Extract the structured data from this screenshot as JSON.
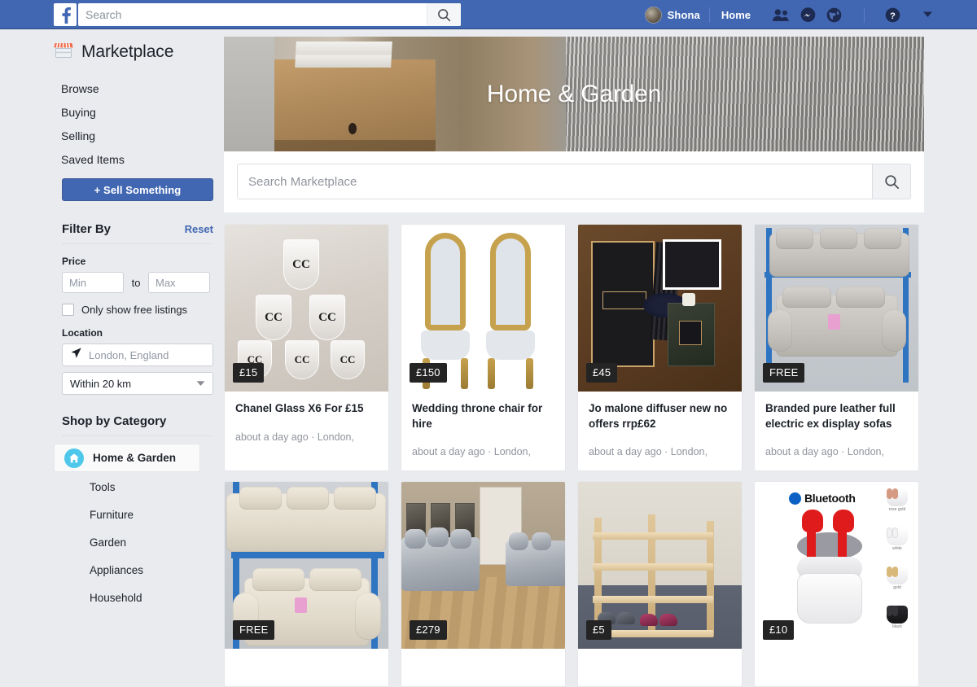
{
  "topbar": {
    "logo_icon": "facebook-f-icon",
    "search_placeholder": "Search",
    "search_value": "",
    "search_icon": "search-icon",
    "user_name": "Shona",
    "home_label": "Home",
    "icons": [
      "friend-requests-icon",
      "messenger-icon",
      "notifications-globe-icon",
      "help-question-icon",
      "account-caret-down-icon"
    ]
  },
  "sidebar": {
    "marketplace_icon": "storefront-icon",
    "marketplace_title": "Marketplace",
    "nav": [
      {
        "label": "Browse"
      },
      {
        "label": "Buying"
      },
      {
        "label": "Selling"
      },
      {
        "label": "Saved Items"
      }
    ],
    "sell_button": "+  Sell Something",
    "filter": {
      "title": "Filter By",
      "reset": "Reset",
      "price_label": "Price",
      "price_min_placeholder": "Min",
      "price_min_value": "",
      "price_max_placeholder": "Max",
      "price_max_value": "",
      "price_to": "to",
      "free_checkbox_label": "Only show free listings",
      "free_checked": false,
      "location_label": "Location",
      "location_icon": "navigation-arrow-icon",
      "location_placeholder": "London, England",
      "location_value": "",
      "distance_value": "Within 20 km",
      "distance_caret": "chevron-down-icon"
    },
    "category": {
      "heading": "Shop by Category",
      "active": {
        "label": "Home & Garden",
        "icon": "home-icon",
        "icon_color": "#4ec7ea"
      },
      "subcategories": [
        {
          "label": "Tools"
        },
        {
          "label": "Furniture"
        },
        {
          "label": "Garden"
        },
        {
          "label": "Appliances"
        },
        {
          "label": "Household"
        }
      ]
    }
  },
  "main": {
    "hero_title": "Home & Garden",
    "search_placeholder": "Search Marketplace",
    "search_value": "",
    "search_icon": "search-icon",
    "listings": [
      {
        "price": "£15",
        "title": "Chanel Glass X6 For £15",
        "meta": "about a day ago · London,",
        "image": "chanel-glasses"
      },
      {
        "price": "£150",
        "title": "Wedding throne chair for hire",
        "meta": "about a day ago · London,",
        "image": "throne-chairs"
      },
      {
        "price": "£45",
        "title": "Jo malone diffuser new no offers rrp£62",
        "meta": "about a day ago · London,",
        "image": "jo-malone-diffuser"
      },
      {
        "price": "FREE",
        "title": "Branded pure leather full electric ex display sofas",
        "meta": "about a day ago · London,",
        "image": "grey-leather-sofas"
      },
      {
        "price": "FREE",
        "title": "",
        "meta": "",
        "image": "cream-leather-sofas"
      },
      {
        "price": "£279",
        "title": "",
        "meta": "",
        "image": "crushed-velvet-sofas"
      },
      {
        "price": "£5",
        "title": "",
        "meta": "",
        "image": "wooden-shoe-rack"
      },
      {
        "price": "£10",
        "title": "",
        "meta": "",
        "image": "bluetooth-earbuds",
        "badge_text": "Bluetooth",
        "variant_labels": [
          "rose gold",
          "white",
          "gold",
          "black"
        ]
      }
    ]
  },
  "colors": {
    "fb_blue": "#4267b2",
    "page_bg": "#e9ebee",
    "card_bg": "#ffffff",
    "price_tag_bg": "#242424",
    "link_blue": "#4267b2",
    "category_icon": "#4ec7ea"
  }
}
